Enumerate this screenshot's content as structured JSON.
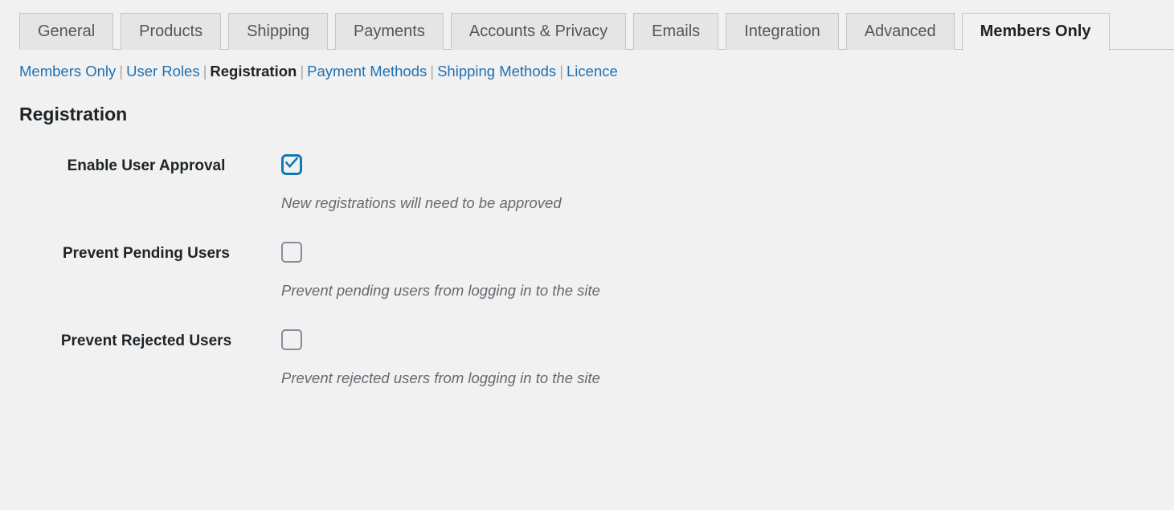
{
  "tabs": [
    {
      "label": "General",
      "active": false
    },
    {
      "label": "Products",
      "active": false
    },
    {
      "label": "Shipping",
      "active": false
    },
    {
      "label": "Payments",
      "active": false
    },
    {
      "label": "Accounts & Privacy",
      "active": false
    },
    {
      "label": "Emails",
      "active": false
    },
    {
      "label": "Integration",
      "active": false
    },
    {
      "label": "Advanced",
      "active": false
    },
    {
      "label": "Members Only",
      "active": true
    }
  ],
  "subnav": {
    "items": [
      {
        "label": "Members Only",
        "current": false
      },
      {
        "label": "User Roles",
        "current": false
      },
      {
        "label": "Registration",
        "current": true
      },
      {
        "label": "Payment Methods",
        "current": false
      },
      {
        "label": "Shipping Methods",
        "current": false
      },
      {
        "label": "Licence",
        "current": false
      }
    ],
    "separator": "|"
  },
  "page": {
    "title": "Registration"
  },
  "settings": [
    {
      "label": "Enable User Approval",
      "checked": true,
      "description": "New registrations will need to be approved"
    },
    {
      "label": "Prevent Pending Users",
      "checked": false,
      "description": "Prevent pending users from logging in to the site"
    },
    {
      "label": "Prevent Rejected Users",
      "checked": false,
      "description": "Prevent rejected users from logging in to the site"
    }
  ],
  "colors": {
    "page_background": "#f1f1f1",
    "tab_inactive_background": "#e5e5e5",
    "tab_border": "#c3c4c7",
    "link_blue": "#2271b1",
    "checkbox_checked": "#1079b5",
    "checkbox_unchecked": "#8c8a9c",
    "text_dark": "#1d2327",
    "text_muted": "#646970"
  },
  "icons": {
    "checkmark": "check-icon"
  }
}
